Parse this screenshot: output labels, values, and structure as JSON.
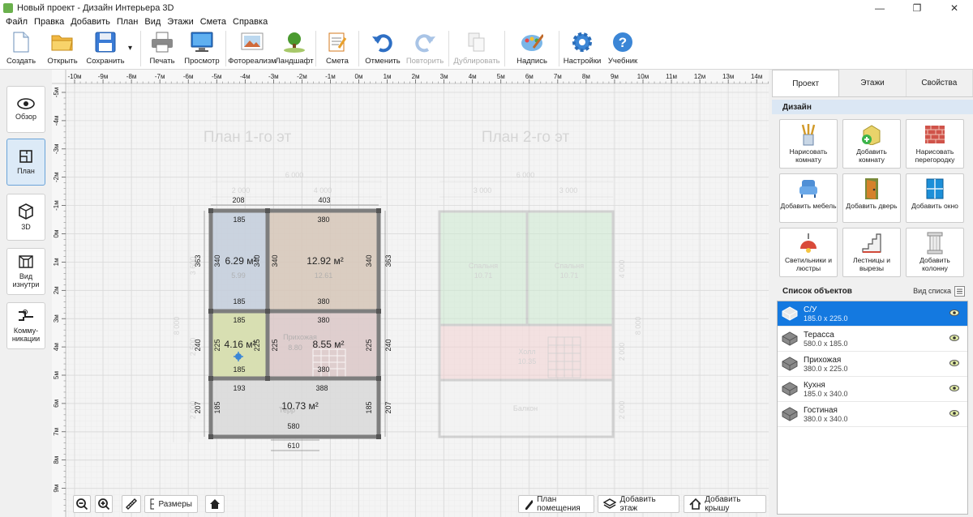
{
  "window": {
    "title": "Новый проект - Дизайн Интерьера 3D",
    "minimize": "—",
    "maximize": "❐",
    "close": "✕"
  },
  "menu": [
    "Файл",
    "Правка",
    "Добавить",
    "План",
    "Вид",
    "Этажи",
    "Смета",
    "Справка"
  ],
  "toolbar": {
    "create": "Создать",
    "open": "Открыть",
    "save": "Сохранить",
    "save_dropdown": "▾",
    "print": "Печать",
    "preview": "Просмотр",
    "photoreal": "Фотореализм",
    "landscape": "Ландшафт",
    "estimate": "Смета",
    "undo": "Отменить",
    "redo": "Повторить",
    "duplicate": "Дублировать",
    "label": "Надпись",
    "settings": "Настройки",
    "tutorial": "Учебник"
  },
  "leftbar": {
    "overview": "Обзор",
    "plan": "План",
    "view3d": "3D",
    "inside": "Вид изнутри",
    "comms": "Комму-никации"
  },
  "ruler": {
    "top": [
      "-10м",
      "-9м",
      "-8м",
      "-7м",
      "-6м",
      "-5м",
      "-4м",
      "-3м",
      "-2м",
      "-1м",
      "0м",
      "1м",
      "2м",
      "3м",
      "4м",
      "5м",
      "6м",
      "7м",
      "8м",
      "9м",
      "10м",
      "11м",
      "12м",
      "13м",
      "14м"
    ],
    "left": [
      "-5м",
      "-4м",
      "-3м",
      "-2м",
      "-1м",
      "0м",
      "1м",
      "2м",
      "3м",
      "4м",
      "5м",
      "6м",
      "7м",
      "8м",
      "9м"
    ]
  },
  "plan": {
    "title1": "План 1-го эт",
    "title2": "План 2-го эт",
    "rooms": [
      {
        "area": "6.29 м²",
        "faint_area": "5.99"
      },
      {
        "area": "12.92 м²",
        "faint_area": "12.61"
      },
      {
        "area": "4.16 м²"
      },
      {
        "area": "8.55 м²",
        "faint_name": "Прихожая",
        "faint_area": "8.80"
      },
      {
        "area": "10.73 м²",
        "faint_name": "Терр"
      }
    ],
    "dims": {
      "d208": "208",
      "d403": "403",
      "d185a": "185",
      "d380a": "380",
      "d340a": "340",
      "d340b": "340",
      "d340c": "340",
      "d340d": "340",
      "d363a": "363",
      "d363b": "363",
      "d185b": "185",
      "d380b": "380",
      "d185c": "185",
      "d380c": "380",
      "d225a": "225",
      "d225b": "225",
      "d225c": "225",
      "d225d": "225",
      "d240a": "240",
      "d240b": "240",
      "d185d": "185",
      "d380d": "380",
      "d193": "193",
      "d388": "388",
      "d185e": "185",
      "d185f": "185",
      "d207a": "207",
      "d207b": "207",
      "d580": "580",
      "d610": "610"
    },
    "faint_dims": {
      "f6000a": "6 000",
      "f2000": "2 000",
      "f4000": "4 000",
      "f3000a": "3 000",
      "f3000b": "3 000",
      "f6000b": "6 000",
      "f3600": "3 600",
      "f2500": "2 500",
      "f8000a": "8 000",
      "f2000v": "2 000",
      "f4000v": "4 000",
      "f8000b": "8 000",
      "f2000v2": "2 000",
      "f2000v3": "2 000"
    },
    "second_floor": {
      "bedroom1": "Спальня",
      "bedroom1_area": "10.71",
      "bedroom2": "Спальня",
      "bedroom2_area": "10.71",
      "hall": "Холл",
      "hall_area": "10.35",
      "balcony": "Балкон"
    }
  },
  "canvas_buttons": {
    "sizes": "Размеры",
    "room_plan": "План помещения",
    "add_floor": "Добавить этаж",
    "add_roof": "Добавить крышу"
  },
  "panel": {
    "tabs": [
      "Проект",
      "Этажи",
      "Свойства"
    ],
    "design_header": "Дизайн",
    "tiles": [
      "Нарисовать комнату",
      "Добавить комнату",
      "Нарисовать перегородку",
      "Добавить мебель",
      "Добавить дверь",
      "Добавить окно",
      "Светильники и люстры",
      "Лестницы и вырезы",
      "Добавить колонну"
    ],
    "objects_header": "Список объектов",
    "view_list": "Вид списка",
    "objects": [
      {
        "name": "С/У",
        "dims": "185.0 x 225.0"
      },
      {
        "name": "Терасса",
        "dims": "580.0 x 185.0"
      },
      {
        "name": "Прихожая",
        "dims": "380.0 x 225.0"
      },
      {
        "name": "Кухня",
        "dims": "185.0 x 340.0"
      },
      {
        "name": "Гостиная",
        "dims": "380.0 x 340.0"
      }
    ]
  },
  "colors": {
    "accent": "#1479e0",
    "room_blue": "#c6cfdc",
    "room_tan": "#d7c9bc",
    "room_green": "#d8dfb2",
    "room_pink": "#dccaca",
    "wall": "#7e7e7e"
  }
}
